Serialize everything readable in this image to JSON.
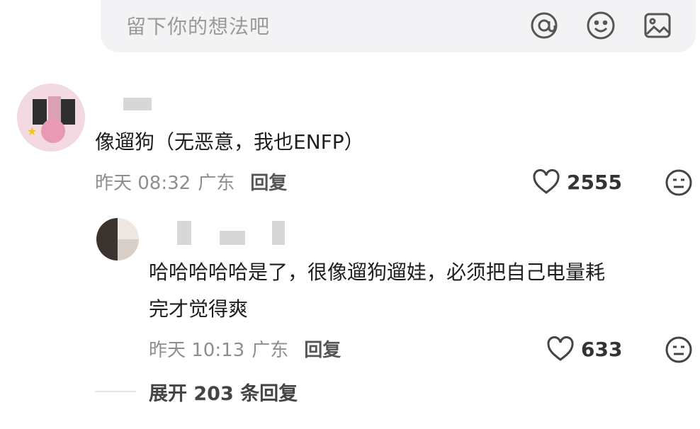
{
  "input": {
    "placeholder": "留下你的想法吧",
    "icons": [
      "at-icon",
      "emoji-icon",
      "image-icon"
    ]
  },
  "comment": {
    "text": "像遛狗（无恶意，我也ENFP）",
    "time": "昨天 08:32",
    "location": "广东",
    "reply_label": "回复",
    "likes": "2555"
  },
  "reply": {
    "text_line1": "哈哈哈哈哈是了，很像遛狗遛娃，必须把自己电量耗",
    "text_line2": "完才觉得爽",
    "time": "昨天 10:13",
    "location": "广东",
    "reply_label": "回复",
    "likes": "633"
  },
  "expand": {
    "label": "展开 203 条回复"
  },
  "colors": {
    "input_bg": "#f3f3f5",
    "meta_text": "#8e8e8e",
    "icon_stroke": "#555555"
  }
}
